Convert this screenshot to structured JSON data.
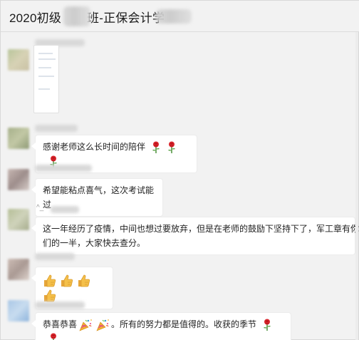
{
  "chat": {
    "title": "2020初级",
    "title_suffix": "班-正保会计学"
  },
  "messages": [
    {
      "type": "image",
      "caption": ""
    },
    {
      "type": "text",
      "text": "感谢老师这么长时间的陪伴",
      "emoji": [
        "rose",
        "rose",
        "rose"
      ]
    },
    {
      "type": "text",
      "text": "希望能粘点喜气，这次考试能过",
      "emoji": []
    },
    {
      "type": "text",
      "line1": "这一年经历了疫情，中间也想过要放弃，但是在老师的鼓励下坚持下了，军工章有你",
      "line2": "们的一半，大家快去查分。",
      "emoji": []
    },
    {
      "type": "emoji-only",
      "emoji": [
        "thumbs-up",
        "thumbs-up",
        "thumbs-up",
        "thumbs-up"
      ]
    },
    {
      "type": "text",
      "prefix": "恭喜恭喜",
      "suffix": "。所有的努力都是值得的。收获的季节",
      "emoji": [
        "party-popper",
        "party-popper",
        "rose",
        "rose"
      ]
    }
  ],
  "sender_hints": {
    "msg4": "^_^"
  },
  "colors": {
    "background": "#f2f2f2",
    "bubble": "#ffffff",
    "text": "#1f1f1f"
  }
}
